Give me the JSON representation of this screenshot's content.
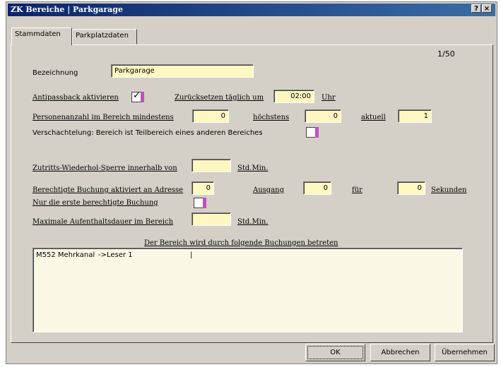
{
  "window": {
    "title": "ZK Bereiche | Parkgarage",
    "help_label": "?",
    "close_label": "×"
  },
  "tabs": [
    {
      "label": "Stammdaten"
    },
    {
      "label": "Parkplatzdaten"
    }
  ],
  "counter": "1/50",
  "form": {
    "bezeichnung": {
      "label": "Bezeichnung",
      "value": "Parkgarage"
    },
    "antipassback": {
      "label": "Antipassback aktivieren",
      "checked": true
    },
    "reset": {
      "label": "Zurücksetzen täglich um",
      "value": "02:00",
      "unit": "Uhr"
    },
    "persons": {
      "label": "Personenanzahl im Bereich mindestens",
      "min_value": "0",
      "max_label": "höchstens",
      "max_value": "0",
      "current_label": "aktuell",
      "current_value": "1"
    },
    "subarea": {
      "label": "Verschachtelung: Bereich ist Teilbereich eines anderen Bereiches",
      "checked": false
    },
    "reentry": {
      "label": "Zutritts-Wiederhol-Sperre innerhalb von",
      "value": "",
      "unit": "Std.Min."
    },
    "booking": {
      "label": "Berechtigte Buchung aktiviert an Adresse",
      "address_value": "0",
      "output_label": "Ausgang",
      "output_value": "0",
      "for_label": "für",
      "seconds_value": "0",
      "seconds_unit": "Sekunden"
    },
    "first_only": {
      "label": "Nur die erste berechtigte Buchung",
      "checked": false
    },
    "max_stay": {
      "label": "Maximale Aufenthaltsdauer im Bereich",
      "value": "",
      "unit": "Std.Min."
    }
  },
  "entry_list": {
    "title": "Der Bereich wird durch folgende Buchungen betreten",
    "rows": [
      {
        "device": "M552 Mehrkanal",
        "reader": "->Leser 1",
        "cursor": "|"
      }
    ]
  },
  "buttons": {
    "ok": "OK",
    "cancel": "Abbrechen",
    "apply": "Übernehmen"
  }
}
